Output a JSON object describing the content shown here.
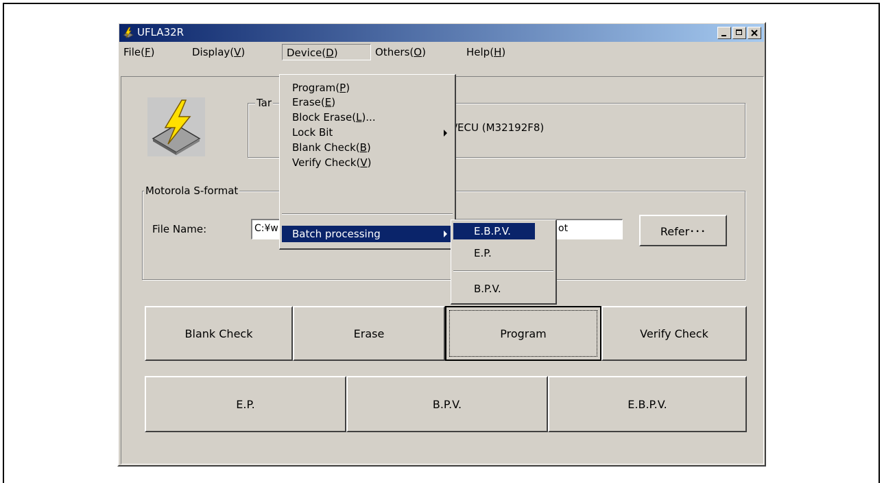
{
  "window": {
    "title": "UFLA32R",
    "minimize": "minimize",
    "maximize": "maximize",
    "close": "close"
  },
  "menubar": [
    {
      "label": "File(",
      "key": "F",
      "end": ")"
    },
    {
      "label": "Display(",
      "key": "V",
      "end": ")"
    },
    {
      "label": "Device(",
      "key": "D",
      "end": ")"
    },
    {
      "label": "Others(",
      "key": "O",
      "end": ")"
    },
    {
      "label": "Help(",
      "key": "H",
      "end": ")"
    }
  ],
  "target_group": {
    "legend": "Tar",
    "value": "/ECU (M32192F8)"
  },
  "file_group": {
    "legend": "Motorola S-format",
    "file_label": "File Name:",
    "file_value_left": "C:¥w",
    "file_value_right": "ot",
    "refer_button": "Refer･･･"
  },
  "device_menu": [
    {
      "label": "Program(",
      "key": "P",
      "end": ")"
    },
    {
      "label": "Erase(",
      "key": "E",
      "end": ")"
    },
    {
      "label": "Block Erase(",
      "key": "L",
      "end": ")..."
    },
    {
      "label": "Lock Bit",
      "key": "",
      "end": ""
    },
    {
      "label": "Blank Check(",
      "key": "B",
      "end": ")"
    },
    {
      "label": "Verify Check(",
      "key": "V",
      "end": ")"
    },
    {
      "label": "Batch processing",
      "key": "",
      "end": ""
    }
  ],
  "batch_submenu": [
    "E.B.P.V.",
    "E.P.",
    "B.P.V."
  ],
  "buttons_row1": [
    "Blank Check",
    "Erase",
    "Program",
    "Verify Check"
  ],
  "buttons_row2": [
    "E.P.",
    "B.P.V.",
    "E.B.P.V."
  ],
  "colors": {
    "title_start": "#0a246a",
    "title_end": "#a6caf0",
    "face": "#d4d0c8",
    "highlight": "#0a246a"
  }
}
